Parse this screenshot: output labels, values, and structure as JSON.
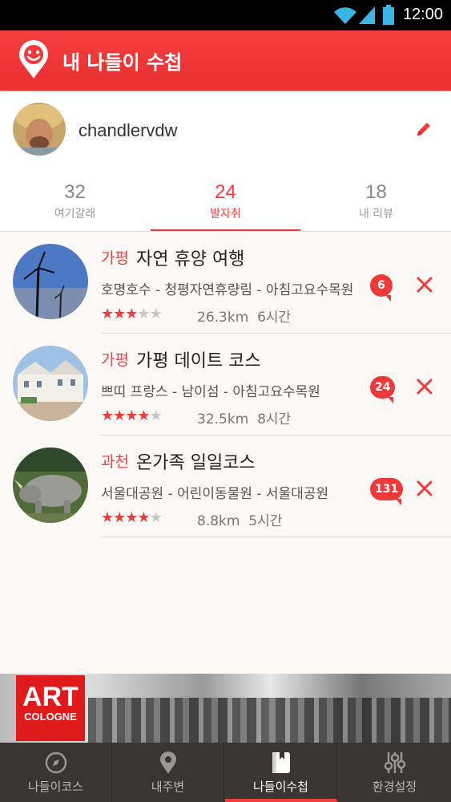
{
  "status_bar": {
    "time": "12:00"
  },
  "header": {
    "title": "내 나들이 수첩"
  },
  "profile": {
    "username": "chandlervdw"
  },
  "tabs": [
    {
      "count": "32",
      "label": "여기갈래",
      "active": false
    },
    {
      "count": "24",
      "label": "발자취",
      "active": true
    },
    {
      "count": "18",
      "label": "내 리뷰",
      "active": false
    }
  ],
  "courses": [
    {
      "region": "가평",
      "name": "자연 휴양 여행",
      "route": "호명호수 - 청평자연휴량림 - 아침고요수목원",
      "rating": 3,
      "distance": "26.3km",
      "duration": "6시간",
      "comments": "6"
    },
    {
      "region": "가평",
      "name": "가평 데이트 코스",
      "route": "쁘띠 프랑스 - 남이섬 - 아침고요수목원",
      "rating": 4,
      "distance": "32.5km",
      "duration": "8시간",
      "comments": "24"
    },
    {
      "region": "과천",
      "name": "온가족 일일코스",
      "route": "서울대공원 - 어린이동물원 - 서울대공원",
      "rating": 4,
      "distance": "8.8km",
      "duration": "5시간",
      "comments": "131"
    }
  ],
  "banner": {
    "line1": "ART",
    "line2": "COLOGNE"
  },
  "bottom_nav": [
    {
      "label": "나들이코스",
      "icon": "compass-icon",
      "active": false
    },
    {
      "label": "내주변",
      "icon": "location-pin-icon",
      "active": false
    },
    {
      "label": "나들이수첩",
      "icon": "notebook-icon",
      "active": true
    },
    {
      "label": "환경설정",
      "icon": "sliders-icon",
      "active": false
    }
  ],
  "colors": {
    "accent": "#ef3b3b",
    "nav_bg": "#3a3533",
    "page_bg": "#fbf8f6"
  }
}
